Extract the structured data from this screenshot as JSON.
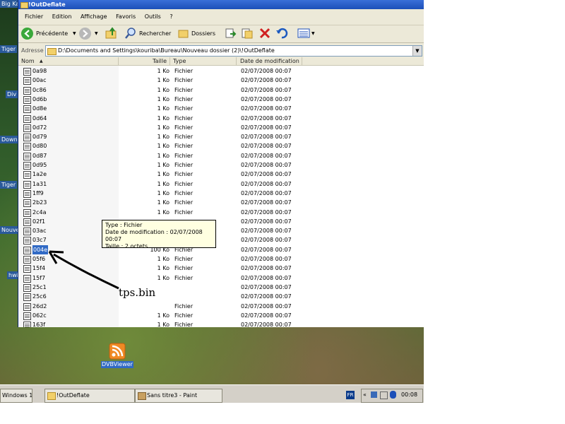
{
  "desktop": {
    "icons": [
      "Big Ka",
      "Tiger",
      "Div",
      "Down",
      "Tiger",
      "Nouve",
      "hwi"
    ],
    "shortcut": "DVBViewer"
  },
  "window": {
    "title": "!OutDeflate",
    "menu": [
      "Fichier",
      "Edition",
      "Affichage",
      "Favoris",
      "Outils",
      "?"
    ],
    "toolbar": {
      "back": "Précédente",
      "search": "Rechercher",
      "folders": "Dossiers"
    },
    "address": {
      "label": "Adresse",
      "value": "D:\\Documents and Settings\\kouriba\\Bureau\\Nouveau dossier (2)\\!OutDeflate"
    }
  },
  "list": {
    "columns": [
      "Nom",
      "Taille",
      "Type",
      "Date de modification"
    ],
    "rows": [
      [
        "0a98",
        "1 Ko",
        "Fichier",
        "02/07/2008 00:07"
      ],
      [
        "00ac",
        "1 Ko",
        "Fichier",
        "02/07/2008 00:07"
      ],
      [
        "0c86",
        "1 Ko",
        "Fichier",
        "02/07/2008 00:07"
      ],
      [
        "0d6b",
        "1 Ko",
        "Fichier",
        "02/07/2008 00:07"
      ],
      [
        "0d8e",
        "1 Ko",
        "Fichier",
        "02/07/2008 00:07"
      ],
      [
        "0d64",
        "1 Ko",
        "Fichier",
        "02/07/2008 00:07"
      ],
      [
        "0d72",
        "1 Ko",
        "Fichier",
        "02/07/2008 00:07"
      ],
      [
        "0d79",
        "1 Ko",
        "Fichier",
        "02/07/2008 00:07"
      ],
      [
        "0d80",
        "1 Ko",
        "Fichier",
        "02/07/2008 00:07"
      ],
      [
        "0d87",
        "1 Ko",
        "Fichier",
        "02/07/2008 00:07"
      ],
      [
        "0d95",
        "1 Ko",
        "Fichier",
        "02/07/2008 00:07"
      ],
      [
        "1a2e",
        "1 Ko",
        "Fichier",
        "02/07/2008 00:07"
      ],
      [
        "1a31",
        "1 Ko",
        "Fichier",
        "02/07/2008 00:07"
      ],
      [
        "1ff9",
        "1 Ko",
        "Fichier",
        "02/07/2008 00:07"
      ],
      [
        "2b23",
        "1 Ko",
        "Fichier",
        "02/07/2008 00:07"
      ],
      [
        "2c4a",
        "1 Ko",
        "Fichier",
        "02/07/2008 00:07"
      ],
      [
        "02f1",
        "",
        "",
        "02/07/2008 00:07"
      ],
      [
        "03ac",
        "",
        "",
        "02/07/2008 00:07"
      ],
      [
        "03c7",
        "",
        "",
        "02/07/2008 00:07"
      ],
      [
        "004e",
        "100 Ko",
        "Fichier",
        "02/07/2008 00:07"
      ],
      [
        "05f6",
        "1 Ko",
        "Fichier",
        "02/07/2008 00:07"
      ],
      [
        "15f4",
        "1 Ko",
        "Fichier",
        "02/07/2008 00:07"
      ],
      [
        "15f7",
        "1 Ko",
        "Fichier",
        "02/07/2008 00:07"
      ],
      [
        "25c1",
        "",
        "",
        "02/07/2008 00:07"
      ],
      [
        "25c6",
        "",
        "",
        "02/07/2008 00:07"
      ],
      [
        "26d2",
        "",
        "Fichier",
        "02/07/2008 00:07"
      ],
      [
        "062c",
        "1 Ko",
        "Fichier",
        "02/07/2008 00:07"
      ],
      [
        "163f",
        "1 Ko",
        "Fichier",
        "02/07/2008 00:07"
      ]
    ],
    "selected_index": 19
  },
  "tooltip": {
    "type": "Type : Fichier",
    "date": "Date de modification : 02/07/2008 00:07",
    "size": "Taille  : 2 octets"
  },
  "annotation": "tps.bin",
  "taskbar": {
    "items": [
      "Windows 1...",
      "!OutDeflate",
      "Sans titre3 - Paint"
    ],
    "lang": "FR",
    "clock": "00:08"
  },
  "colors": {
    "title_bar": "#1c4fb8",
    "selection": "#316ac5",
    "tooltip_bg": "#ffffe1"
  }
}
